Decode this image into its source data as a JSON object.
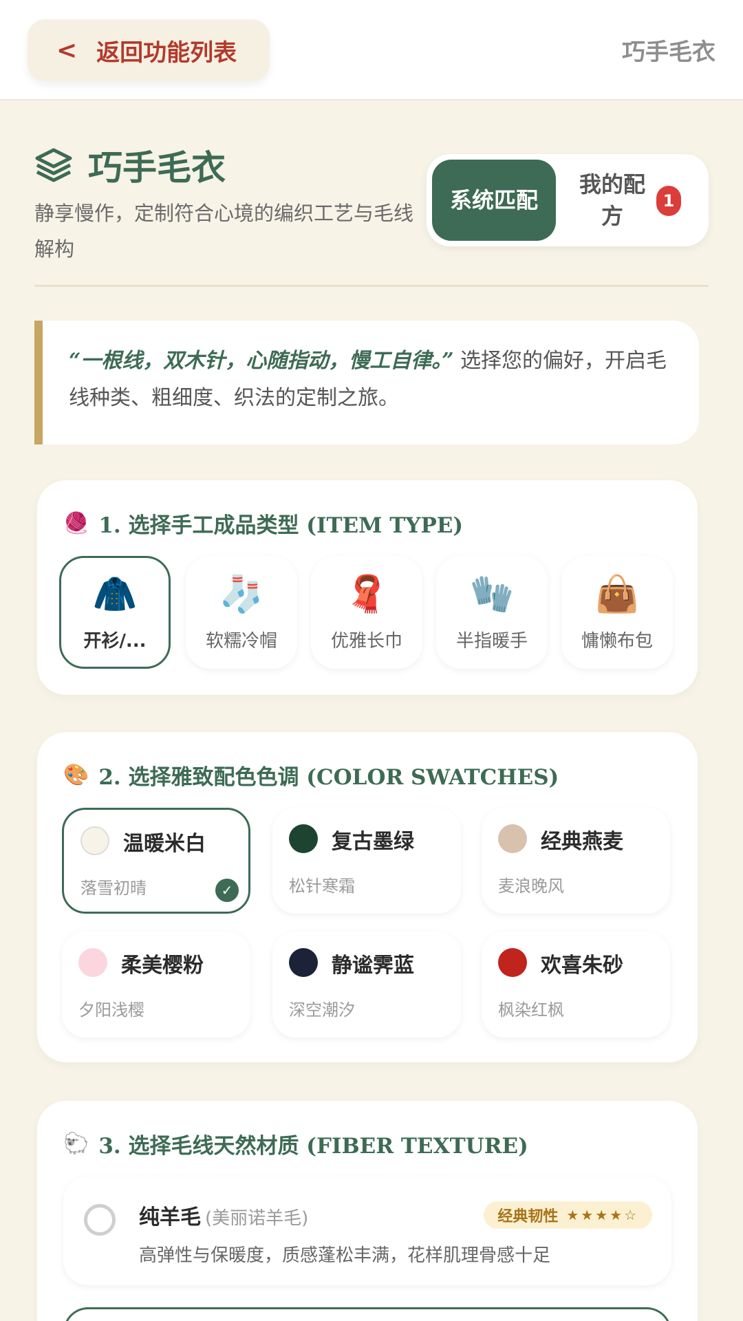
{
  "topbar": {
    "back_label": "返回功能列表",
    "title": "巧手毛衣"
  },
  "header": {
    "title": "巧手毛衣",
    "subtitle": "静享慢作，定制符合心境的编织工艺与毛线解构",
    "tabs": [
      {
        "label": "系统匹配",
        "active": true
      },
      {
        "label": "我的配方",
        "active": false,
        "badge": "1"
      }
    ]
  },
  "quote": {
    "emphasis": "“一根线，双木针，心随指动，慢工自律。”",
    "text": "选择您的偏好，开启毛线种类、粗细度、织法的定制之旅。"
  },
  "item_type": {
    "title": "1. 选择手工成品类型 (ITEM TYPE)",
    "title_icon": "yarn-ball",
    "items": [
      {
        "icon": "🧥",
        "label": "开衫/...",
        "selected": true
      },
      {
        "icon": "🧦",
        "label": "软糯冷帽",
        "selected": false
      },
      {
        "icon": "🧣",
        "label": "优雅长巾",
        "selected": false
      },
      {
        "icon": "🧤",
        "label": "半指暖手",
        "selected": false
      },
      {
        "icon": "👜",
        "label": "慵懒布包",
        "selected": false
      }
    ]
  },
  "colors": {
    "title": "2. 选择雅致配色色调 (COLOR SWATCHES)",
    "title_icon": "palette",
    "swatches": [
      {
        "name": "温暖米白",
        "sub": "落雪初晴",
        "color": "#f7f3e8",
        "selected": true
      },
      {
        "name": "复古墨绿",
        "sub": "松针寒霜",
        "color": "#1d4331",
        "selected": false
      },
      {
        "name": "经典燕麦",
        "sub": "麦浪晚风",
        "color": "#d8c2ad",
        "selected": false
      },
      {
        "name": "柔美樱粉",
        "sub": "夕阳浅樱",
        "color": "#fbd6df",
        "selected": false
      },
      {
        "name": "静谧霁蓝",
        "sub": "深空潮汐",
        "color": "#1c2238",
        "selected": false
      },
      {
        "name": "欢喜朱砂",
        "sub": "枫染红枫",
        "color": "#c1231d",
        "selected": false
      }
    ]
  },
  "fiber": {
    "title": "3. 选择毛线天然材质 (FIBER TEXTURE)",
    "title_icon": "sheep",
    "options": [
      {
        "name": "纯羊毛",
        "alt": "(美丽诺羊毛)",
        "tag": "经典韧性",
        "stars": "★★★★☆",
        "desc": "高弹性与保暖度，质感蓬松丰满，花样肌理骨感十足"
      }
    ]
  },
  "theme": {
    "accent": "#3d6b55",
    "back_color": "#b23a2c",
    "gold": "#c7a662",
    "background": "#f7f3e6"
  }
}
